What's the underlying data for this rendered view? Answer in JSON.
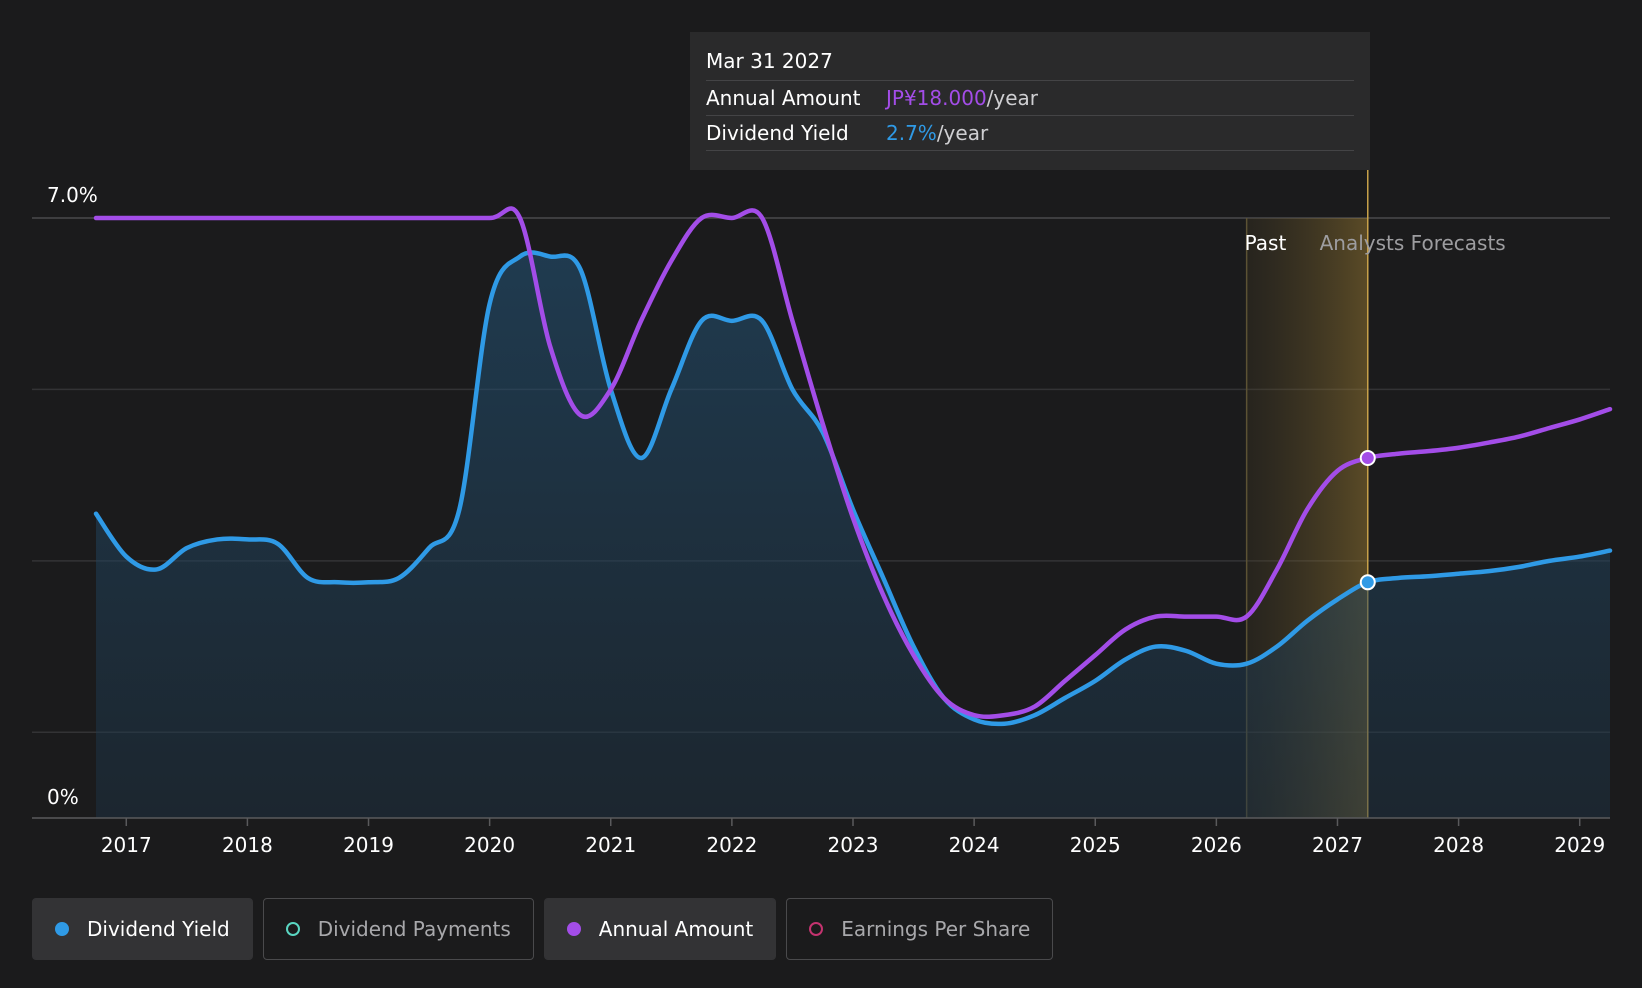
{
  "tooltip": {
    "date": "Mar 31 2027",
    "rows": [
      {
        "label": "Annual Amount",
        "value": "JP¥18.000",
        "unit": "/year"
      },
      {
        "label": "Dividend Yield",
        "value": "2.7%",
        "unit": "/year"
      }
    ]
  },
  "regions": {
    "past": "Past",
    "forecast": "Analysts Forecasts"
  },
  "legend": [
    {
      "label": "Dividend Yield",
      "color": "#2f9ae6",
      "active": true,
      "filled": true
    },
    {
      "label": "Dividend Payments",
      "color": "#5ad6c2",
      "active": false,
      "filled": false
    },
    {
      "label": "Annual Amount",
      "color": "#a34de8",
      "active": true,
      "filled": true
    },
    {
      "label": "Earnings Per Share",
      "color": "#c4336f",
      "active": false,
      "filled": false
    }
  ],
  "chart_data": {
    "type": "area",
    "x_ticks": [
      "2017",
      "2018",
      "2019",
      "2020",
      "2021",
      "2022",
      "2023",
      "2024",
      "2025",
      "2026",
      "2027",
      "2028",
      "2029"
    ],
    "y_ticks": [
      "7.0%",
      "0%"
    ],
    "ylim": [
      0,
      7.0
    ],
    "xlim": [
      2016.75,
      2029.25
    ],
    "grid": true,
    "past_forecast_split": 2026.25,
    "highlight_x": 2027.25,
    "series": [
      {
        "name": "Dividend Yield",
        "color": "#2f9ae6",
        "fill": true,
        "x": [
          2016.75,
          2017.0,
          2017.25,
          2017.5,
          2017.75,
          2018.0,
          2018.25,
          2018.5,
          2018.75,
          2019.0,
          2019.25,
          2019.5,
          2019.75,
          2020.0,
          2020.25,
          2020.5,
          2020.75,
          2021.0,
          2021.25,
          2021.5,
          2021.75,
          2022.0,
          2022.25,
          2022.5,
          2022.75,
          2023.0,
          2023.25,
          2023.5,
          2023.75,
          2024.0,
          2024.25,
          2024.5,
          2024.75,
          2025.0,
          2025.25,
          2025.5,
          2025.75,
          2026.0,
          2026.25,
          2026.5,
          2026.75,
          2027.0,
          2027.25,
          2027.5,
          2027.75,
          2028.0,
          2028.25,
          2028.5,
          2028.75,
          2029.0,
          2029.25
        ],
        "y": [
          3.55,
          3.05,
          2.9,
          3.15,
          3.25,
          3.25,
          3.2,
          2.8,
          2.75,
          2.75,
          2.8,
          3.15,
          3.6,
          6.0,
          6.55,
          6.55,
          6.4,
          5.0,
          4.2,
          5.0,
          5.8,
          5.8,
          5.8,
          5.0,
          4.5,
          3.6,
          2.8,
          2.0,
          1.4,
          1.15,
          1.1,
          1.2,
          1.4,
          1.6,
          1.85,
          2.0,
          1.95,
          1.8,
          1.8,
          2.0,
          2.3,
          2.55,
          2.75,
          2.8,
          2.82,
          2.85,
          2.88,
          2.93,
          3.0,
          3.05,
          3.12
        ]
      },
      {
        "name": "Annual Amount",
        "color": "#a34de8",
        "fill": false,
        "x": [
          2016.75,
          2017.0,
          2017.5,
          2018.0,
          2018.5,
          2019.0,
          2019.5,
          2020.0,
          2020.25,
          2020.5,
          2020.75,
          2021.0,
          2021.25,
          2021.5,
          2021.75,
          2022.0,
          2022.25,
          2022.5,
          2022.75,
          2023.0,
          2023.25,
          2023.5,
          2023.75,
          2024.0,
          2024.25,
          2024.5,
          2024.75,
          2025.0,
          2025.25,
          2025.5,
          2025.75,
          2026.0,
          2026.25,
          2026.5,
          2026.75,
          2027.0,
          2027.25,
          2027.5,
          2027.75,
          2028.0,
          2028.25,
          2028.5,
          2028.75,
          2029.0,
          2029.25
        ],
        "y": [
          7.0,
          7.0,
          7.0,
          7.0,
          7.0,
          7.0,
          7.0,
          7.0,
          7.0,
          5.5,
          4.7,
          5.0,
          5.8,
          6.5,
          7.0,
          7.0,
          7.0,
          5.8,
          4.6,
          3.5,
          2.6,
          1.9,
          1.4,
          1.2,
          1.2,
          1.3,
          1.6,
          1.9,
          2.2,
          2.35,
          2.35,
          2.35,
          2.35,
          2.9,
          3.6,
          4.05,
          4.2,
          4.25,
          4.28,
          4.32,
          4.38,
          4.45,
          4.55,
          4.65,
          4.77
        ]
      }
    ]
  }
}
